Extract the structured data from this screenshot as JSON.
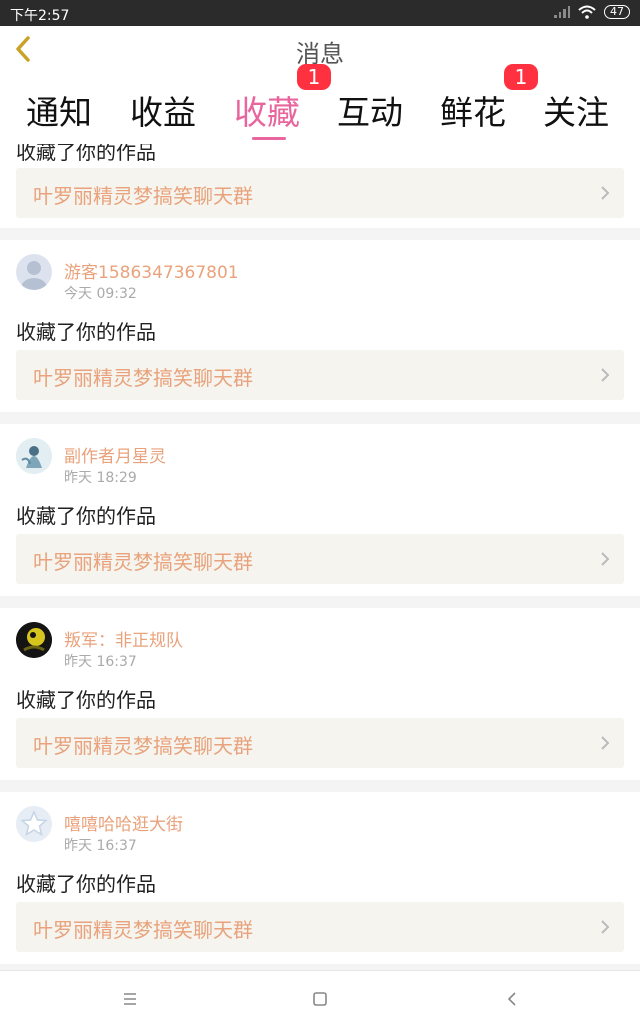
{
  "status": {
    "time": "下午2:57",
    "battery": "47"
  },
  "header": {
    "title": "消息"
  },
  "tabs": [
    {
      "label": "通知",
      "badge": ""
    },
    {
      "label": "收益",
      "badge": ""
    },
    {
      "label": "收藏",
      "badge": "1"
    },
    {
      "label": "互动",
      "badge": ""
    },
    {
      "label": "鲜花",
      "badge": "1"
    },
    {
      "label": "关注",
      "badge": ""
    }
  ],
  "partial": {
    "action": "收藏了你的作品",
    "work": "叶罗丽精灵梦搞笑聊天群"
  },
  "items": [
    {
      "user": "游客1586347367801",
      "time": "今天 09:32",
      "action": "收藏了你的作品",
      "work": "叶罗丽精灵梦搞笑聊天群"
    },
    {
      "user": "副作者月星灵",
      "time": "昨天 18:29",
      "action": "收藏了你的作品",
      "work": "叶罗丽精灵梦搞笑聊天群"
    },
    {
      "user": "叛军：非正规队",
      "time": "昨天 16:37",
      "action": "收藏了你的作品",
      "work": "叶罗丽精灵梦搞笑聊天群"
    },
    {
      "user": "嘻嘻哈哈逛大街",
      "time": "昨天 16:37",
      "action": "收藏了你的作品",
      "work": "叶罗丽精灵梦搞笑聊天群"
    }
  ],
  "colors": {
    "accent": "#e8659d",
    "badge": "#ff3141",
    "username": "#e9a27b"
  }
}
